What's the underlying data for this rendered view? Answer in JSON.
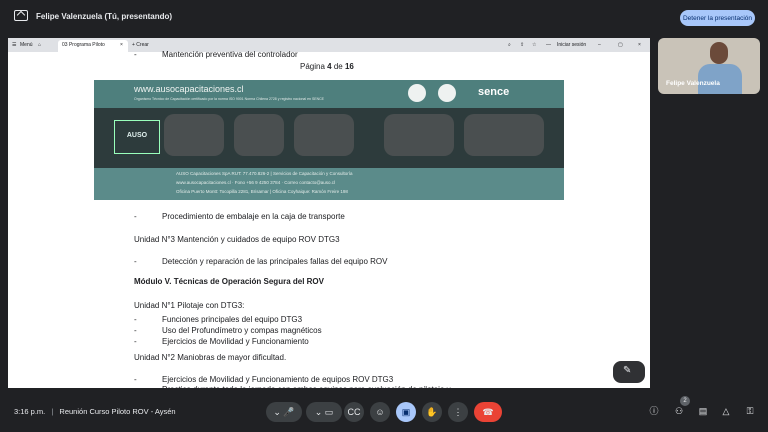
{
  "meet": {
    "presenter_title": "Felipe Valenzuela (Tú, presentando)",
    "stop_button": "Detener la presentación",
    "self_name": "Felipe Valenzuela",
    "time": "3:16 p.m.",
    "separator": "|",
    "meeting_name": "Reunión Curso Piloto ROV - Aysén",
    "participant_count": "2"
  },
  "browser": {
    "menu_label": "Menú",
    "tab_title": "03 Programa Piloto",
    "new_tab": "+ Crear",
    "login": "Iniciar sesión"
  },
  "document": {
    "top_line_bullet": "-",
    "top_line": "Mantención preventiva del controlador",
    "page_prefix": "Página",
    "page_num": "4",
    "page_of": "de",
    "page_total": "16",
    "banner": {
      "url": "www.ausocapacitaciones.cl",
      "subtitle": "Organismo Técnico de Capacitación certificado por la norma ISO 9001 Norma Chilena 2728 y registro nacional en SENCE",
      "logo_text": "AUSO",
      "brand": "sence",
      "footer1": "AUSO Capacitaciones SpA RUT: 77.470.826-2 |  Servicios de Capacitación y Consultoría",
      "footer2": "www.ausocapacitaciones.cl · Fono +56 9 4250 3784 · Correo contacto@auso.cl",
      "footer3": "Oficina Puerto Montt: Tocopilla 2281, Brisamar  |  Oficina Coyhaique: Ramón Freire 198"
    },
    "lines": [
      {
        "bullet": "-",
        "text": "Procedimiento de embalaje en la caja de transporte"
      },
      {
        "bullet": "",
        "text": "Unidad N°3 Mantención y cuidados de equipo ROV DTG3"
      },
      {
        "bullet": "-",
        "text": "Detección y reparación de las principales fallas del equipo ROV"
      },
      {
        "bullet": "",
        "text": "Módulo V. Técnicas de Operación Segura del ROV"
      },
      {
        "bullet": "",
        "text": "Unidad N°1 Pilotaje con DTG3:"
      },
      {
        "bullet": "-",
        "text": "Funciones principales del equipo DTG3"
      },
      {
        "bullet": "-",
        "text": "Uso del Profundímetro y compas magnéticos"
      },
      {
        "bullet": "-",
        "text": "Ejercicios de Movilidad y Funcionamiento"
      },
      {
        "bullet": "",
        "text": "Unidad N°2 Maniobras de mayor dificultad."
      },
      {
        "bullet": "-",
        "text": "Ejercicios de Movilidad y Funcionamiento de equipos ROV DTG3"
      },
      {
        "bullet": "-",
        "text": "Practica durante toda la jornada con ambos equipos para evaluación de pilotaje y"
      }
    ]
  },
  "icons": {
    "mic": "microphone-icon",
    "cam": "camera-icon",
    "cc": "captions-icon",
    "emoji": "emoji-icon",
    "present": "present-icon",
    "hand": "raise-hand-icon",
    "more": "more-icon",
    "end": "end-call-icon",
    "info": "info-icon",
    "people": "people-icon",
    "chat": "chat-icon",
    "activities": "activities-icon",
    "lock": "lock-icon"
  }
}
